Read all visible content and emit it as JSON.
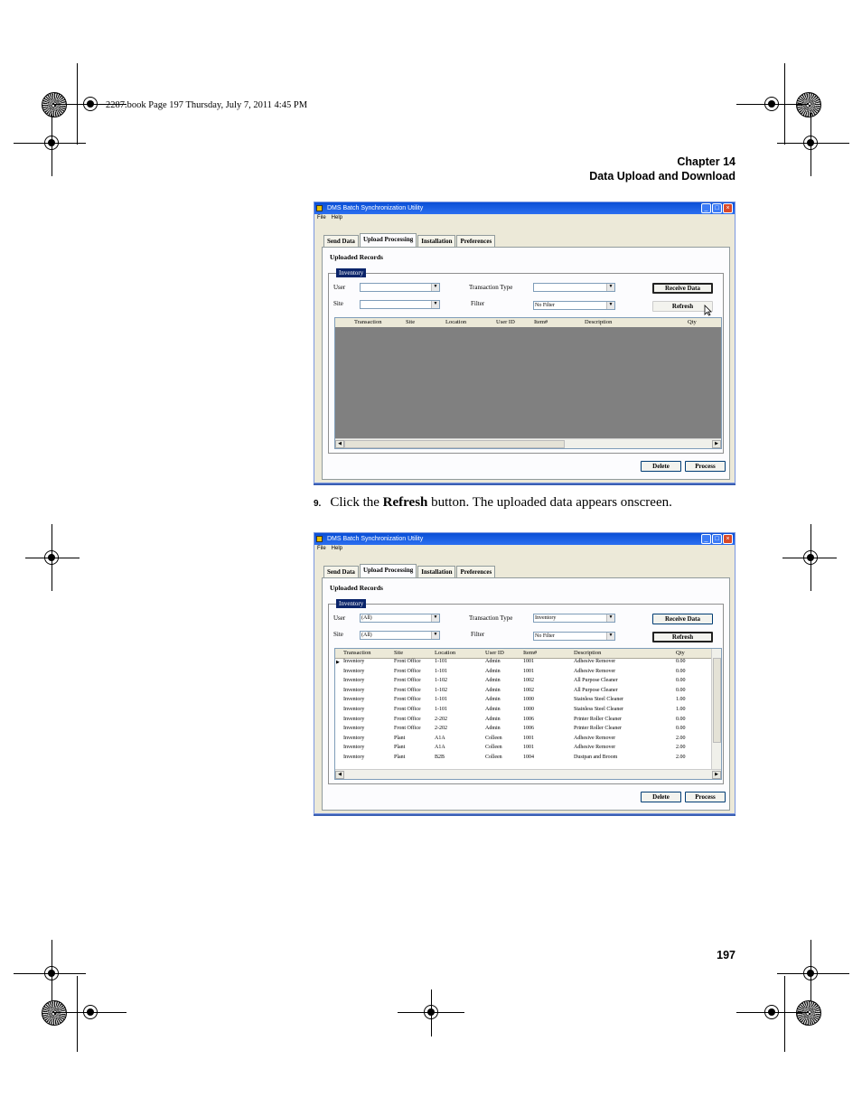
{
  "slug": "2287.book  Page 197  Thursday, July 7, 2011  4:45 PM",
  "header": {
    "chapter": "Chapter 14",
    "section": "Data Upload and Download"
  },
  "page_number": "197",
  "step": {
    "number": "9.",
    "before": "Click the ",
    "bold": "Refresh",
    "after": " button. The uploaded data appears onscreen."
  },
  "app": {
    "title": "DMS Batch Synchronization Utility",
    "menu": [
      "File",
      "Help"
    ],
    "tabs": [
      "Send Data",
      "Upload Processing",
      "Installation",
      "Preferences"
    ],
    "group_title": "Uploaded Records",
    "legend": "Inventory",
    "labels": {
      "user": "User",
      "site": "Site",
      "transaction_type": "Transaction Type",
      "filter": "Filter"
    },
    "buttons": {
      "receive": "Receive Data",
      "refresh": "Refresh",
      "delete": "Delete",
      "process": "Process"
    },
    "columns": [
      "Transaction",
      "Site",
      "Location",
      "User ID",
      "Item#",
      "Description",
      "Qty"
    ]
  },
  "screen1": {
    "user": "",
    "site": "",
    "transaction_type": "",
    "filter": "No Filter"
  },
  "screen2": {
    "user": "(All)",
    "site": "(All)",
    "transaction_type": "Inventory",
    "filter": "No Filter",
    "rows": [
      [
        "Inventory",
        "Front Office",
        "1-101",
        "Admin",
        "1001",
        "Adhesive Remover",
        "0.00"
      ],
      [
        "Inventory",
        "Front Office",
        "1-101",
        "Admin",
        "1001",
        "Adhesive Remover",
        "0.00"
      ],
      [
        "Inventory",
        "Front Office",
        "1-102",
        "Admin",
        "1002",
        "All Purpose Cleaner",
        "0.00"
      ],
      [
        "Inventory",
        "Front Office",
        "1-102",
        "Admin",
        "1002",
        "All Purpose Cleaner",
        "0.00"
      ],
      [
        "Inventory",
        "Front Office",
        "1-101",
        "Admin",
        "1000",
        "Stainless Steel Cleaner",
        "1.00"
      ],
      [
        "Inventory",
        "Front Office",
        "1-101",
        "Admin",
        "1000",
        "Stainless Steel Cleaner",
        "1.00"
      ],
      [
        "Inventory",
        "Front Office",
        "2-202",
        "Admin",
        "1006",
        "Printer Roller Cleaner",
        "0.00"
      ],
      [
        "Inventory",
        "Front Office",
        "2-202",
        "Admin",
        "1006",
        "Printer Roller Cleaner",
        "0.00"
      ],
      [
        "Inventory",
        "Plant",
        "A1A",
        "Colleen",
        "1001",
        "Adhesive Remover",
        "2.00"
      ],
      [
        "Inventory",
        "Plant",
        "A1A",
        "Colleen",
        "1001",
        "Adhesive Remover",
        "2.00"
      ],
      [
        "Inventory",
        "Plant",
        "B2B",
        "Colleen",
        "1004",
        "Dustpan and Broom",
        "2.00"
      ]
    ]
  }
}
